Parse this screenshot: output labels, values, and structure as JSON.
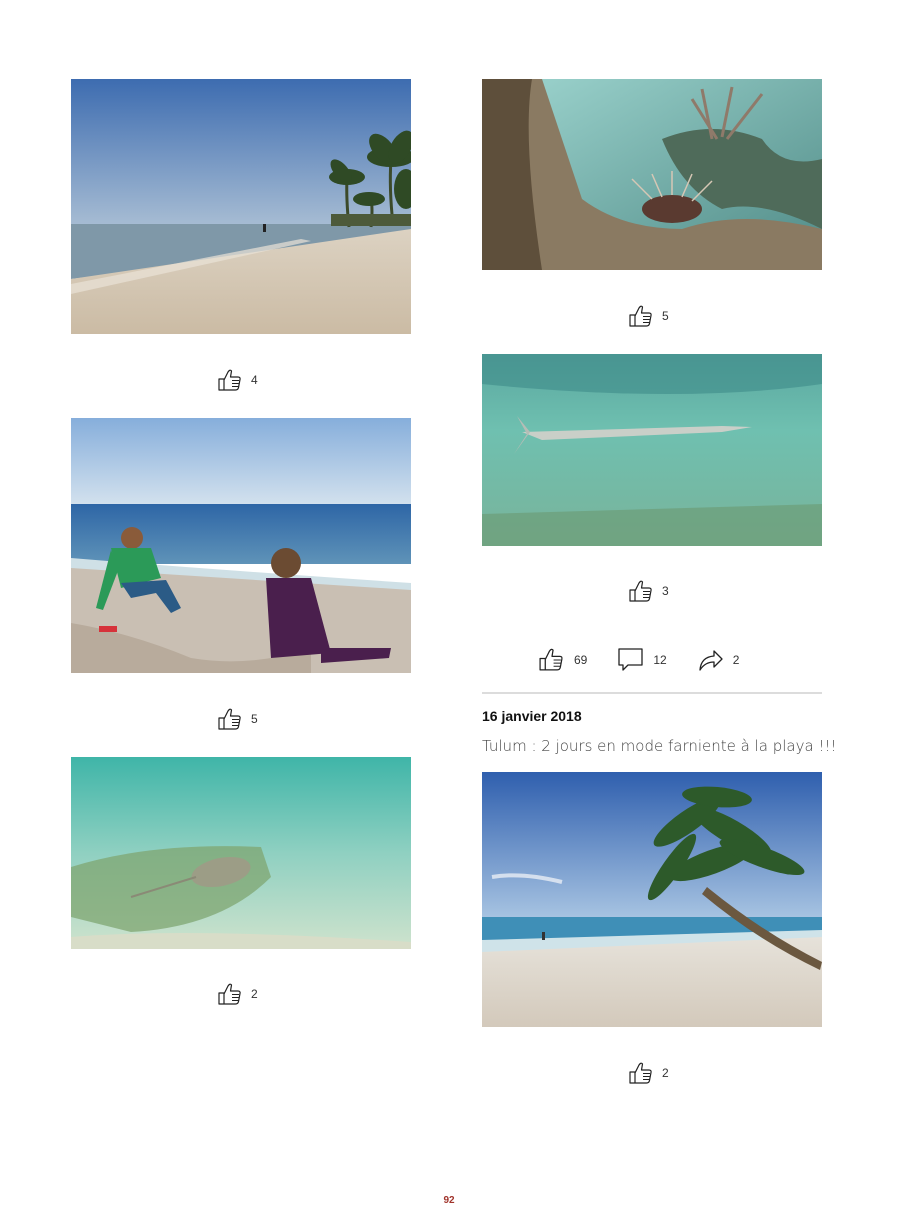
{
  "photos": [
    {
      "id": "beach-palms",
      "likes": "4"
    },
    {
      "id": "kids-sandcastle",
      "likes": "5"
    },
    {
      "id": "stingray",
      "likes": "2"
    },
    {
      "id": "lionfish-reef",
      "likes": "5"
    },
    {
      "id": "needlefish",
      "likes": "3"
    },
    {
      "id": "tulum-palm",
      "likes": "2"
    }
  ],
  "post_stats": {
    "likes": "69",
    "comments": "12",
    "shares": "2"
  },
  "post": {
    "date": "16 janvier 2018",
    "caption": "Tulum : 2 jours en mode farniente à la playa !!!"
  },
  "page_number": "92",
  "icons": {
    "like": "thumbs-up-icon",
    "comment": "comment-bubble-icon",
    "share": "share-arrow-icon"
  },
  "colors": {
    "page_number": "#a0332b",
    "divider": "#dcdcdc"
  }
}
